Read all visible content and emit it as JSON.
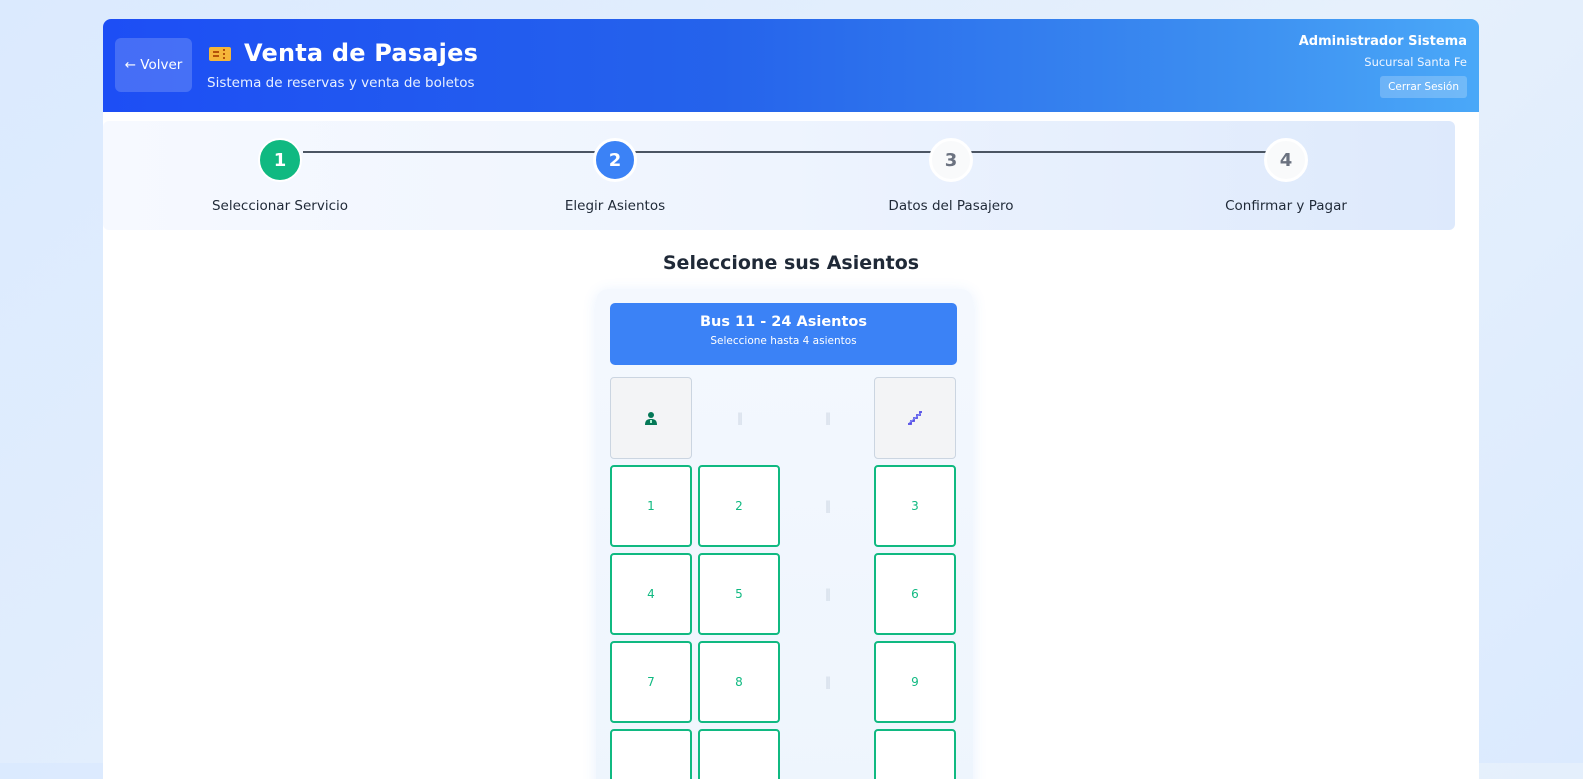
{
  "header": {
    "back_label": "← Volver",
    "title": "Venta de Pasajes",
    "subtitle": "Sistema de reservas y venta de boletos",
    "user_name": "Administrador Sistema",
    "branch": "Sucursal Santa Fe",
    "logout_label": "Cerrar Sesión"
  },
  "steps": [
    {
      "number": "1",
      "label": "Seleccionar Servicio",
      "state": "done"
    },
    {
      "number": "2",
      "label": "Elegir Asientos",
      "state": "active"
    },
    {
      "number": "3",
      "label": "Datos del Pasajero",
      "state": "pending"
    },
    {
      "number": "4",
      "label": "Confirmar y Pagar",
      "state": "pending"
    }
  ],
  "main": {
    "section_title": "Seleccione sus Asientos",
    "bus_title": "Bus 11 - 24 Asientos",
    "bus_subtitle": "Seleccione hasta 4 asientos",
    "aisle_glyph": "||",
    "seats": [
      "1",
      "2",
      "3",
      "4",
      "5",
      "6",
      "7",
      "8",
      "9"
    ]
  },
  "icons": {
    "driver": "driver-icon",
    "stairs": "stairs-icon",
    "ticket": "ticket-icon"
  },
  "colors": {
    "header_start": "#1d4ef5",
    "header_end": "#4aa8f8",
    "step_done": "#10b981",
    "step_active": "#3b82f6",
    "seat_available": "#10b981"
  }
}
